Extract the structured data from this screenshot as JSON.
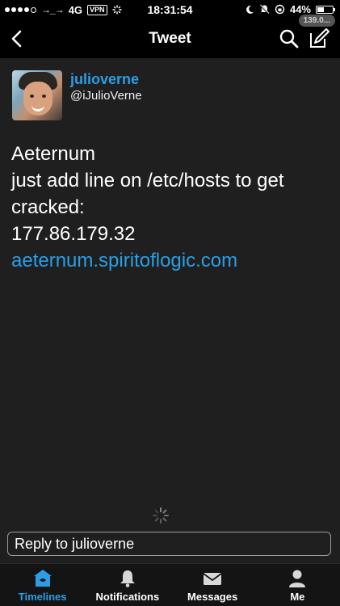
{
  "status_bar": {
    "carrier_arrows": "→_→",
    "network": "4G",
    "vpn": "VPN",
    "time": "18:31:54",
    "battery": "44%",
    "battery_level": 0.44
  },
  "nav": {
    "title": "Tweet",
    "counter_badge": "139.0..."
  },
  "tweet": {
    "author_name": "julioverne",
    "author_handle": "@iJulioVerne",
    "lines": [
      "Aeternum",
      "just add line on /etc/hosts to get",
      "cracked:",
      "177.86.179.32"
    ],
    "link": "aeternum.spiritoflogic.com"
  },
  "reply": {
    "placeholder": "Reply to julioverne"
  },
  "tabs": [
    {
      "label": "Timelines",
      "icon": "house-icon",
      "active": true
    },
    {
      "label": "Notifications",
      "icon": "bell-icon",
      "active": false
    },
    {
      "label": "Messages",
      "icon": "envelope-icon",
      "active": false
    },
    {
      "label": "Me",
      "icon": "person-icon",
      "active": false
    }
  ],
  "colors": {
    "accent": "#2a9fe6",
    "background": "#1f1f1f",
    "bar": "#000000"
  }
}
